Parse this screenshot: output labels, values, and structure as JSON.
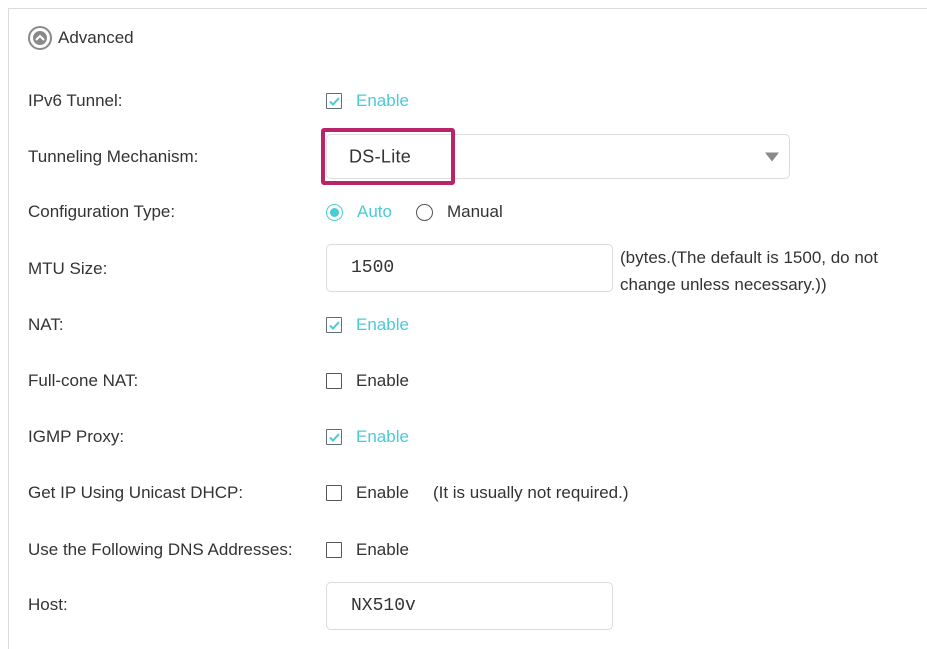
{
  "advanced": {
    "label": "Advanced"
  },
  "ipv6_tunnel": {
    "label": "IPv6 Tunnel:",
    "option": "Enable",
    "checked": true
  },
  "tunneling_mechanism": {
    "label": "Tunneling Mechanism:",
    "value": "DS-Lite"
  },
  "configuration_type": {
    "label": "Configuration Type:",
    "options": [
      {
        "label": "Auto",
        "selected": true
      },
      {
        "label": "Manual",
        "selected": false
      }
    ]
  },
  "mtu_size": {
    "label": "MTU Size:",
    "value": "1500",
    "note_line1": "(bytes.(The default is 1500, do not",
    "note_line2": "change unless necessary.))"
  },
  "nat": {
    "label": "NAT:",
    "option": "Enable",
    "checked": true
  },
  "full_cone_nat": {
    "label": "Full-cone NAT:",
    "option": "Enable",
    "checked": false
  },
  "igmp_proxy": {
    "label": "IGMP Proxy:",
    "option": "Enable",
    "checked": true
  },
  "unicast_dhcp": {
    "label": "Get IP Using Unicast DHCP:",
    "option": "Enable",
    "checked": false,
    "note": "(It is usually not required.)"
  },
  "dns_addresses": {
    "label": "Use the Following DNS Addresses:",
    "option": "Enable",
    "checked": false
  },
  "host": {
    "label": "Host:",
    "value": "NX510v"
  },
  "colors": {
    "accent": "#4acbd6",
    "highlight": "#b8236a",
    "text": "#333333",
    "border": "#dcdcdc"
  }
}
